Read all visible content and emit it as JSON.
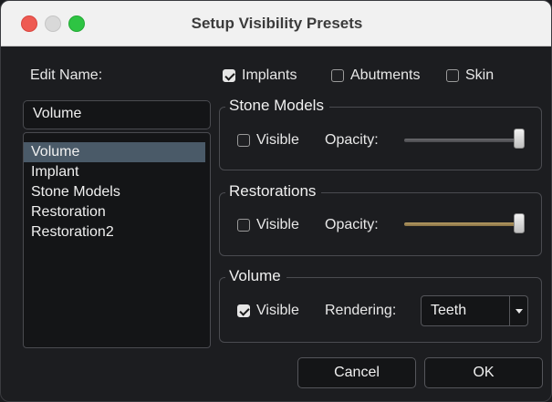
{
  "window": {
    "title": "Setup Visibility Presets"
  },
  "edit_name": {
    "label": "Edit Name:",
    "value": "Volume"
  },
  "presets": {
    "items": [
      "Volume",
      "Implant",
      "Stone Models",
      "Restoration",
      "Restoration2"
    ],
    "selected": "Volume"
  },
  "top_checks": {
    "implants": {
      "label": "Implants",
      "checked": true
    },
    "abutments": {
      "label": "Abutments",
      "checked": false
    },
    "skin": {
      "label": "Skin",
      "checked": false
    }
  },
  "stone_models": {
    "title": "Stone Models",
    "visible_label": "Visible",
    "visible_checked": false,
    "opacity_label": "Opacity:",
    "opacity_value": 1.0
  },
  "restorations": {
    "title": "Restorations",
    "visible_label": "Visible",
    "visible_checked": false,
    "opacity_label": "Opacity:",
    "opacity_value": 1.0
  },
  "volume": {
    "title": "Volume",
    "visible_label": "Visible",
    "visible_checked": true,
    "rendering_label": "Rendering:",
    "rendering_value": "Teeth"
  },
  "buttons": {
    "cancel": "Cancel",
    "ok": "OK"
  },
  "colors": {
    "accent_gold": "#b49a62",
    "selection": "#4a5a68"
  }
}
